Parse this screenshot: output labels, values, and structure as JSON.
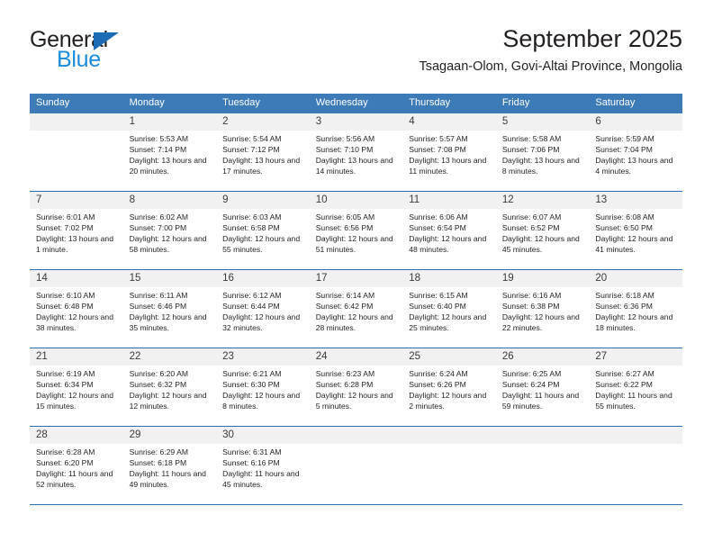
{
  "brand": {
    "name_part1": "General",
    "name_part2": "Blue",
    "accent_color": "#1b8bdc",
    "triangle_color": "#1b6cb5"
  },
  "header": {
    "title": "September 2025",
    "subtitle": "Tsagaan-Olom, Govi-Altai Province, Mongolia"
  },
  "calendar": {
    "header_bg": "#3c7ab8",
    "daynum_bg": "#f1f1f1",
    "separator_color": "#2f6fab",
    "weekday_headers": [
      "Sunday",
      "Monday",
      "Tuesday",
      "Wednesday",
      "Thursday",
      "Friday",
      "Saturday"
    ],
    "weeks": [
      [
        {
          "day": "",
          "sunrise": "",
          "sunset": "",
          "daylight": ""
        },
        {
          "day": "1",
          "sunrise": "Sunrise: 5:53 AM",
          "sunset": "Sunset: 7:14 PM",
          "daylight": "Daylight: 13 hours and 20 minutes."
        },
        {
          "day": "2",
          "sunrise": "Sunrise: 5:54 AM",
          "sunset": "Sunset: 7:12 PM",
          "daylight": "Daylight: 13 hours and 17 minutes."
        },
        {
          "day": "3",
          "sunrise": "Sunrise: 5:56 AM",
          "sunset": "Sunset: 7:10 PM",
          "daylight": "Daylight: 13 hours and 14 minutes."
        },
        {
          "day": "4",
          "sunrise": "Sunrise: 5:57 AM",
          "sunset": "Sunset: 7:08 PM",
          "daylight": "Daylight: 13 hours and 11 minutes."
        },
        {
          "day": "5",
          "sunrise": "Sunrise: 5:58 AM",
          "sunset": "Sunset: 7:06 PM",
          "daylight": "Daylight: 13 hours and 8 minutes."
        },
        {
          "day": "6",
          "sunrise": "Sunrise: 5:59 AM",
          "sunset": "Sunset: 7:04 PM",
          "daylight": "Daylight: 13 hours and 4 minutes."
        }
      ],
      [
        {
          "day": "7",
          "sunrise": "Sunrise: 6:01 AM",
          "sunset": "Sunset: 7:02 PM",
          "daylight": "Daylight: 13 hours and 1 minute."
        },
        {
          "day": "8",
          "sunrise": "Sunrise: 6:02 AM",
          "sunset": "Sunset: 7:00 PM",
          "daylight": "Daylight: 12 hours and 58 minutes."
        },
        {
          "day": "9",
          "sunrise": "Sunrise: 6:03 AM",
          "sunset": "Sunset: 6:58 PM",
          "daylight": "Daylight: 12 hours and 55 minutes."
        },
        {
          "day": "10",
          "sunrise": "Sunrise: 6:05 AM",
          "sunset": "Sunset: 6:56 PM",
          "daylight": "Daylight: 12 hours and 51 minutes."
        },
        {
          "day": "11",
          "sunrise": "Sunrise: 6:06 AM",
          "sunset": "Sunset: 6:54 PM",
          "daylight": "Daylight: 12 hours and 48 minutes."
        },
        {
          "day": "12",
          "sunrise": "Sunrise: 6:07 AM",
          "sunset": "Sunset: 6:52 PM",
          "daylight": "Daylight: 12 hours and 45 minutes."
        },
        {
          "day": "13",
          "sunrise": "Sunrise: 6:08 AM",
          "sunset": "Sunset: 6:50 PM",
          "daylight": "Daylight: 12 hours and 41 minutes."
        }
      ],
      [
        {
          "day": "14",
          "sunrise": "Sunrise: 6:10 AM",
          "sunset": "Sunset: 6:48 PM",
          "daylight": "Daylight: 12 hours and 38 minutes."
        },
        {
          "day": "15",
          "sunrise": "Sunrise: 6:11 AM",
          "sunset": "Sunset: 6:46 PM",
          "daylight": "Daylight: 12 hours and 35 minutes."
        },
        {
          "day": "16",
          "sunrise": "Sunrise: 6:12 AM",
          "sunset": "Sunset: 6:44 PM",
          "daylight": "Daylight: 12 hours and 32 minutes."
        },
        {
          "day": "17",
          "sunrise": "Sunrise: 6:14 AM",
          "sunset": "Sunset: 6:42 PM",
          "daylight": "Daylight: 12 hours and 28 minutes."
        },
        {
          "day": "18",
          "sunrise": "Sunrise: 6:15 AM",
          "sunset": "Sunset: 6:40 PM",
          "daylight": "Daylight: 12 hours and 25 minutes."
        },
        {
          "day": "19",
          "sunrise": "Sunrise: 6:16 AM",
          "sunset": "Sunset: 6:38 PM",
          "daylight": "Daylight: 12 hours and 22 minutes."
        },
        {
          "day": "20",
          "sunrise": "Sunrise: 6:18 AM",
          "sunset": "Sunset: 6:36 PM",
          "daylight": "Daylight: 12 hours and 18 minutes."
        }
      ],
      [
        {
          "day": "21",
          "sunrise": "Sunrise: 6:19 AM",
          "sunset": "Sunset: 6:34 PM",
          "daylight": "Daylight: 12 hours and 15 minutes."
        },
        {
          "day": "22",
          "sunrise": "Sunrise: 6:20 AM",
          "sunset": "Sunset: 6:32 PM",
          "daylight": "Daylight: 12 hours and 12 minutes."
        },
        {
          "day": "23",
          "sunrise": "Sunrise: 6:21 AM",
          "sunset": "Sunset: 6:30 PM",
          "daylight": "Daylight: 12 hours and 8 minutes."
        },
        {
          "day": "24",
          "sunrise": "Sunrise: 6:23 AM",
          "sunset": "Sunset: 6:28 PM",
          "daylight": "Daylight: 12 hours and 5 minutes."
        },
        {
          "day": "25",
          "sunrise": "Sunrise: 6:24 AM",
          "sunset": "Sunset: 6:26 PM",
          "daylight": "Daylight: 12 hours and 2 minutes."
        },
        {
          "day": "26",
          "sunrise": "Sunrise: 6:25 AM",
          "sunset": "Sunset: 6:24 PM",
          "daylight": "Daylight: 11 hours and 59 minutes."
        },
        {
          "day": "27",
          "sunrise": "Sunrise: 6:27 AM",
          "sunset": "Sunset: 6:22 PM",
          "daylight": "Daylight: 11 hours and 55 minutes."
        }
      ],
      [
        {
          "day": "28",
          "sunrise": "Sunrise: 6:28 AM",
          "sunset": "Sunset: 6:20 PM",
          "daylight": "Daylight: 11 hours and 52 minutes."
        },
        {
          "day": "29",
          "sunrise": "Sunrise: 6:29 AM",
          "sunset": "Sunset: 6:18 PM",
          "daylight": "Daylight: 11 hours and 49 minutes."
        },
        {
          "day": "30",
          "sunrise": "Sunrise: 6:31 AM",
          "sunset": "Sunset: 6:16 PM",
          "daylight": "Daylight: 11 hours and 45 minutes."
        },
        {
          "day": "",
          "sunrise": "",
          "sunset": "",
          "daylight": ""
        },
        {
          "day": "",
          "sunrise": "",
          "sunset": "",
          "daylight": ""
        },
        {
          "day": "",
          "sunrise": "",
          "sunset": "",
          "daylight": ""
        },
        {
          "day": "",
          "sunrise": "",
          "sunset": "",
          "daylight": ""
        }
      ]
    ]
  }
}
